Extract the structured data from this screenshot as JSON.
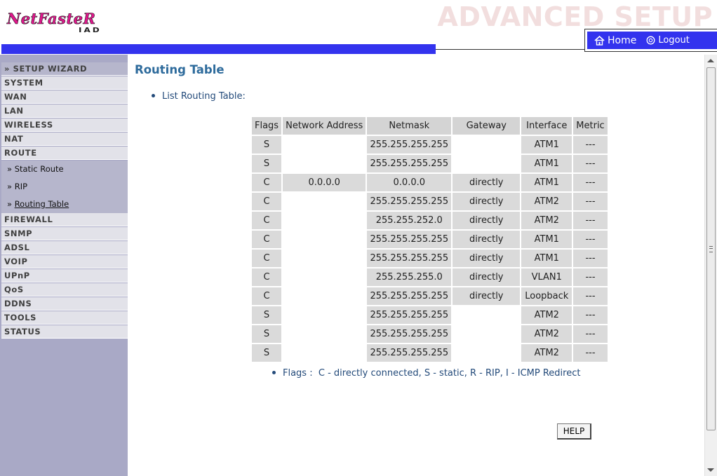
{
  "brand": {
    "logo_text": "NetFasteR",
    "logo_sub": "IAD"
  },
  "header": {
    "title": "ADVANCED SETUP",
    "nav": {
      "home": "Home",
      "logout": "Logout"
    }
  },
  "sidebar": {
    "items": [
      {
        "label": "» SETUP WIZARD"
      },
      {
        "label": "SYSTEM"
      },
      {
        "label": "WAN"
      },
      {
        "label": "LAN"
      },
      {
        "label": "WIRELESS"
      },
      {
        "label": "NAT"
      },
      {
        "label": "ROUTE"
      },
      {
        "label": "FIREWALL"
      },
      {
        "label": "SNMP"
      },
      {
        "label": "ADSL"
      },
      {
        "label": "VOIP"
      },
      {
        "label": "UPnP"
      },
      {
        "label": "QoS"
      },
      {
        "label": "DDNS"
      },
      {
        "label": "TOOLS"
      },
      {
        "label": "STATUS"
      }
    ],
    "route_subitems": [
      {
        "label": "Static Route"
      },
      {
        "label": "RIP"
      },
      {
        "label": "Routing Table"
      }
    ],
    "sub_marker": "»"
  },
  "main": {
    "title": "Routing Table",
    "list_label": "List Routing Table:",
    "table": {
      "headers": [
        "Flags",
        "Network Address",
        "Netmask",
        "Gateway",
        "Interface",
        "Metric"
      ],
      "rows": [
        {
          "flags": "S",
          "network": "",
          "netmask": "255.255.255.255",
          "gateway": "",
          "interface": "ATM1",
          "metric": "---"
        },
        {
          "flags": "S",
          "network": "",
          "netmask": "255.255.255.255",
          "gateway": "",
          "interface": "ATM1",
          "metric": "---"
        },
        {
          "flags": "C",
          "network": "0.0.0.0",
          "netmask": "0.0.0.0",
          "gateway": "directly",
          "interface": "ATM1",
          "metric": "---"
        },
        {
          "flags": "C",
          "network": "",
          "netmask": "255.255.255.255",
          "gateway": "directly",
          "interface": "ATM2",
          "metric": "---"
        },
        {
          "flags": "C",
          "network": "",
          "netmask": "255.255.252.0",
          "gateway": "directly",
          "interface": "ATM2",
          "metric": "---"
        },
        {
          "flags": "C",
          "network": "",
          "netmask": "255.255.255.255",
          "gateway": "directly",
          "interface": "ATM1",
          "metric": "---"
        },
        {
          "flags": "C",
          "network": "",
          "netmask": "255.255.255.255",
          "gateway": "directly",
          "interface": "ATM1",
          "metric": "---"
        },
        {
          "flags": "C",
          "network": "",
          "netmask": "255.255.255.0",
          "gateway": "directly",
          "interface": "VLAN1",
          "metric": "---"
        },
        {
          "flags": "C",
          "network": "",
          "netmask": "255.255.255.255",
          "gateway": "directly",
          "interface": "Loopback",
          "metric": "---"
        },
        {
          "flags": "S",
          "network": "",
          "netmask": "255.255.255.255",
          "gateway": "",
          "interface": "ATM2",
          "metric": "---"
        },
        {
          "flags": "S",
          "network": "",
          "netmask": "255.255.255.255",
          "gateway": "",
          "interface": "ATM2",
          "metric": "---"
        },
        {
          "flags": "S",
          "network": "",
          "netmask": "255.255.255.255",
          "gateway": "",
          "interface": "ATM2",
          "metric": "---"
        }
      ]
    },
    "flags_legend_label": "Flags :",
    "flags_legend": "C - directly connected, S - static, R - RIP, I - ICMP Redirect",
    "help_button": "HELP"
  },
  "colors": {
    "accent_blue": "#3333ee",
    "title_blue": "#2e6b9c",
    "brand_pink": "#e0168c",
    "sidebar_bg": "#a9a9c6"
  }
}
